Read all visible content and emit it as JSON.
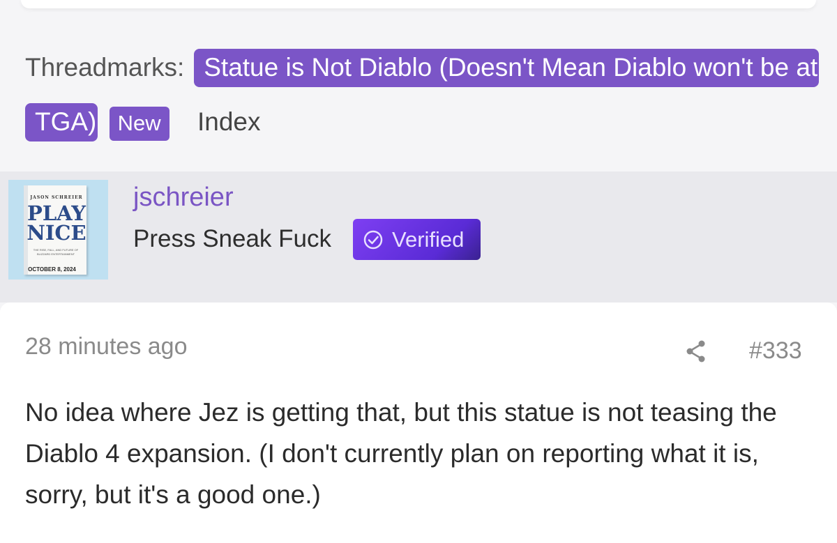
{
  "threadmarks": {
    "label": "Threadmarks:",
    "current_mark": "Statue is Not Diablo (Doesn't Mean Diablo won't be at TGA)",
    "new_badge": "New",
    "index_link": "Index"
  },
  "author": {
    "username": "jschreier",
    "user_title": "Press Sneak Fuck",
    "verified_label": "Verified",
    "avatar": {
      "book_author": "JASON SCHREIER",
      "book_title_line1": "PLAY",
      "book_title_line2": "NICE",
      "book_subtitle": "THE RISE, FALL, AND FUTURE OF BLIZZARD ENTERTAINMENT",
      "release_date": "OCTOBER 8, 2024"
    }
  },
  "post": {
    "timestamp": "28 minutes ago",
    "number": "#333",
    "share_icon": "share-icon",
    "body": "No idea where Jez is getting that, but this statue is not teasing the Diablo 4 expansion. (I don't currently plan on reporting what it is, sorry, but it's a good one.)"
  },
  "colors": {
    "accent": "#7b55c7",
    "username": "#7a55c4",
    "verified_badge": "#6a35e4"
  }
}
